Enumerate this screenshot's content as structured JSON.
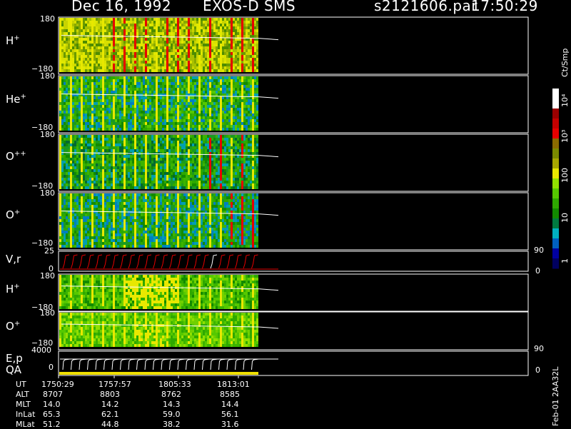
{
  "header": {
    "date": "Dec 16, 1992",
    "instrument": "EXOS-D SMS",
    "file": "s2121606.par",
    "time": "17:50:29"
  },
  "panels": [
    {
      "name": "H+",
      "label_main": "H",
      "label_sup": "+",
      "ymax": "180",
      "ymin": "−180"
    },
    {
      "name": "He+",
      "label_main": "He",
      "label_sup": "+",
      "ymax": "180",
      "ymin": "−180"
    },
    {
      "name": "O++",
      "label_main": "O",
      "label_sup": "++",
      "ymax": "180",
      "ymin": "−180"
    },
    {
      "name": "O+",
      "label_main": "O",
      "label_sup": "+",
      "ymax": "180",
      "ymin": "−180"
    },
    {
      "name": "V,r",
      "label_main": "V,r",
      "label_sup": "",
      "ymax": "25",
      "ymin": "0",
      "right_max": "90",
      "right_min": "0"
    },
    {
      "name": "H+ (2)",
      "label_main": "H",
      "label_sup": "+",
      "ymax": "180",
      "ymin": "−180"
    },
    {
      "name": "O+ (2)",
      "label_main": "O",
      "label_sup": "+",
      "ymax": "180",
      "ymin": "−180"
    },
    {
      "name": "E,p",
      "label_main": "E,p",
      "label_sup": "",
      "ymax": "4000",
      "ymin": "0",
      "right_max": "90",
      "right_min": "0"
    }
  ],
  "qa_label": "QA",
  "colorbar": {
    "unit": "Ct/Smp",
    "ticks": [
      "10⁴",
      "10³",
      "100",
      "10",
      "1"
    ],
    "colors": [
      "#ffffff",
      "#ffffff",
      "#9a0000",
      "#c40000",
      "#e60000",
      "#8a6a00",
      "#7a8a00",
      "#a8a800",
      "#e8e800",
      "#90e000",
      "#55c800",
      "#2ea800",
      "#128a00",
      "#007a40",
      "#00b0c0",
      "#0060c0",
      "#0000a0",
      "#000060"
    ]
  },
  "ephemeris": {
    "labels": [
      "UT",
      "ALT",
      "MLT",
      "InLat",
      "MLat"
    ],
    "columns": [
      [
        "1750:29",
        "8707",
        "14.0",
        "65.3",
        "51.2"
      ],
      [
        "1757:57",
        "8803",
        "14.2",
        "62.1",
        "44.8"
      ],
      [
        "1805:33",
        "8762",
        "14.3",
        "59.0",
        "38.2"
      ],
      [
        "1813:01",
        "8585",
        "14.4",
        "56.1",
        "31.6"
      ]
    ]
  },
  "footer_code": "Feb-01 2AA32L",
  "chart_data": {
    "type": "heatmap",
    "title": "Dec 16, 1992 EXOS-D SMS",
    "x_ticks": [
      "1750:29",
      "1757:57",
      "1805:33",
      "1813:01"
    ],
    "panels": [
      "H+",
      "He+",
      "O++",
      "O+",
      "V,r",
      "H+",
      "O+",
      "E,p"
    ],
    "colorbar_ticks": [
      "1",
      "10",
      "100",
      "10³",
      "10⁴"
    ],
    "colorbar_unit": "Ct/Smp"
  }
}
